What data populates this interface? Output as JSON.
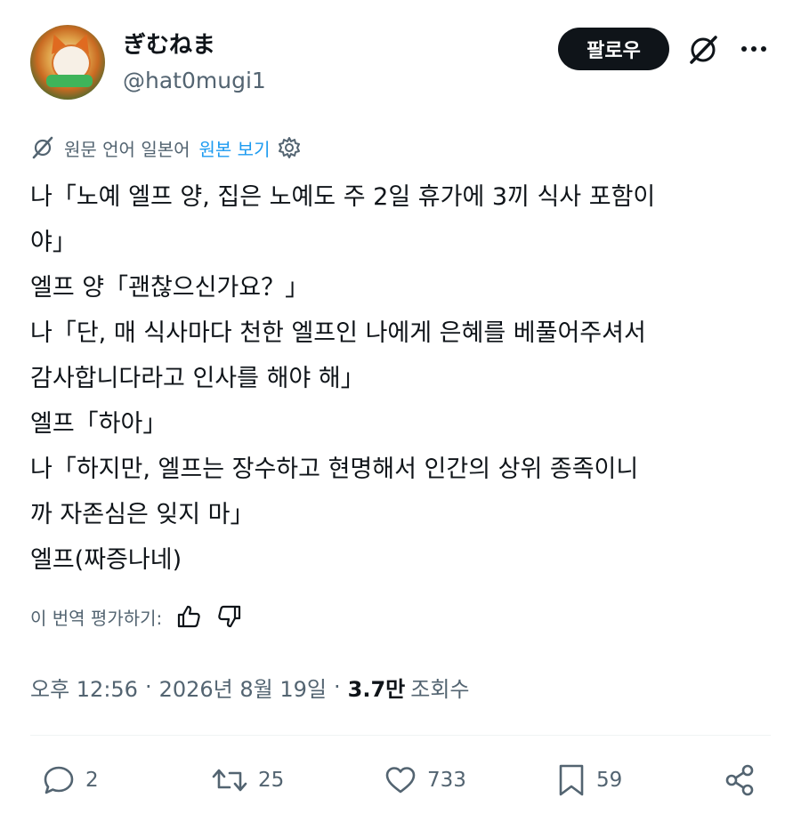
{
  "author": {
    "display_name": "ぎむねま",
    "handle": "@hat0mugi1",
    "follow_label": "팔로우"
  },
  "translation": {
    "source_text": "원문 언어 일본어",
    "view_original": "원본 보기"
  },
  "post": {
    "lines": [
      "나「노예 엘프 양, 집은 노예도 주 2일 휴가에 3끼 식사 포함이",
      "야」",
      "엘프 양「괜찮으신가요？」",
      "나「단, 매 식사마다 천한 엘프인 나에게 은혜를 베풀어주셔서",
      "감사합니다라고 인사를 해야 해」",
      "엘프「하아」",
      "나「하지만, 엘프는 장수하고 현명해서 인간의 상위 종족이니",
      "까 자존심은 잊지 마」",
      "엘프(짜증나네)"
    ]
  },
  "rating": {
    "label": "이 번역 평가하기:"
  },
  "meta": {
    "time": "오후 12:56",
    "date": "2026년 8월 19일",
    "views": "3.7만",
    "views_label": "조회수"
  },
  "actions": {
    "replies": "2",
    "reposts": "25",
    "likes": "733",
    "bookmarks": "59"
  },
  "icons": [
    "grok-icon",
    "more-icon",
    "translate-icon",
    "gear-icon",
    "thumbs-up-icon",
    "thumbs-down-icon",
    "reply-icon",
    "repost-icon",
    "like-icon",
    "bookmark-icon",
    "share-icon"
  ],
  "colors": {
    "link": "#1d9bf0",
    "muted": "#536471",
    "text": "#0f1419"
  }
}
